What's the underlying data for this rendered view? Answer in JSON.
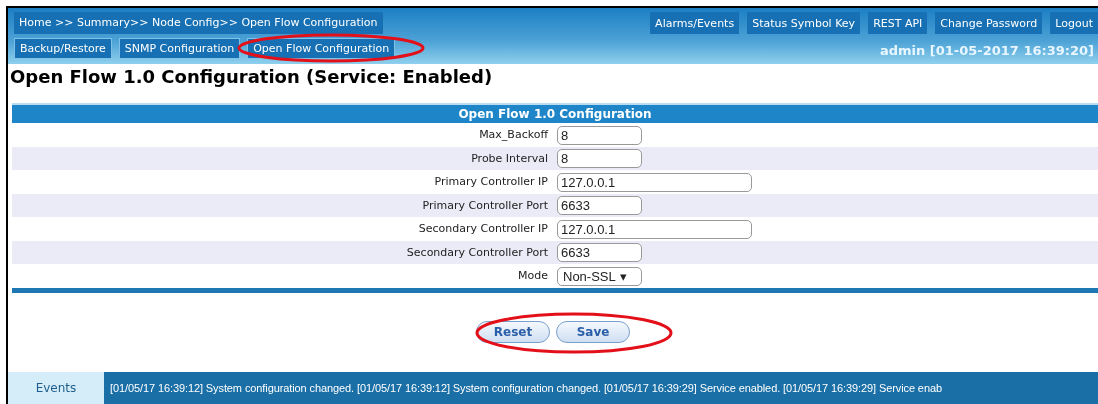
{
  "breadcrumb": "Home >> Summary>> Node Config>> Open Flow Configuration",
  "top_links": [
    "Alarms/Events",
    "Status Symbol Key",
    "REST API",
    "Change Password",
    "Logout"
  ],
  "tabs": [
    {
      "label": "Backup/Restore",
      "annotated": false
    },
    {
      "label": "SNMP Configuration",
      "annotated": false
    },
    {
      "label": "Open Flow Configuration",
      "annotated": true
    }
  ],
  "user_status": "admin [01-05-2017 16:39:20]",
  "page_title": "Open Flow 1.0 Configuration (Service: Enabled)",
  "table": {
    "header": "Open Flow 1.0 Configuration",
    "rows": [
      {
        "label": "Max_Backoff",
        "kind": "short",
        "value": "8"
      },
      {
        "label": "Probe Interval",
        "kind": "short",
        "value": "8"
      },
      {
        "label": "Primary Controller IP",
        "kind": "long",
        "value": "127.0.0.1"
      },
      {
        "label": "Primary Controller Port",
        "kind": "short",
        "value": "6633"
      },
      {
        "label": "Secondary Controller IP",
        "kind": "long",
        "value": "127.0.0.1"
      },
      {
        "label": "Secondary Controller Port",
        "kind": "short",
        "value": "6633"
      },
      {
        "label": "Mode",
        "kind": "select",
        "value": "Non-SSL",
        "arrow": "▾"
      }
    ]
  },
  "buttons": [
    "Reset",
    "Save"
  ],
  "buttons_annotated": true,
  "events": {
    "label": "Events",
    "text": "[01/05/17 16:39:12] System configuration changed. [01/05/17 16:39:12] System configuration changed. [01/05/17 16:39:29] Service enabled. [01/05/17 16:39:29] Service enab"
  }
}
